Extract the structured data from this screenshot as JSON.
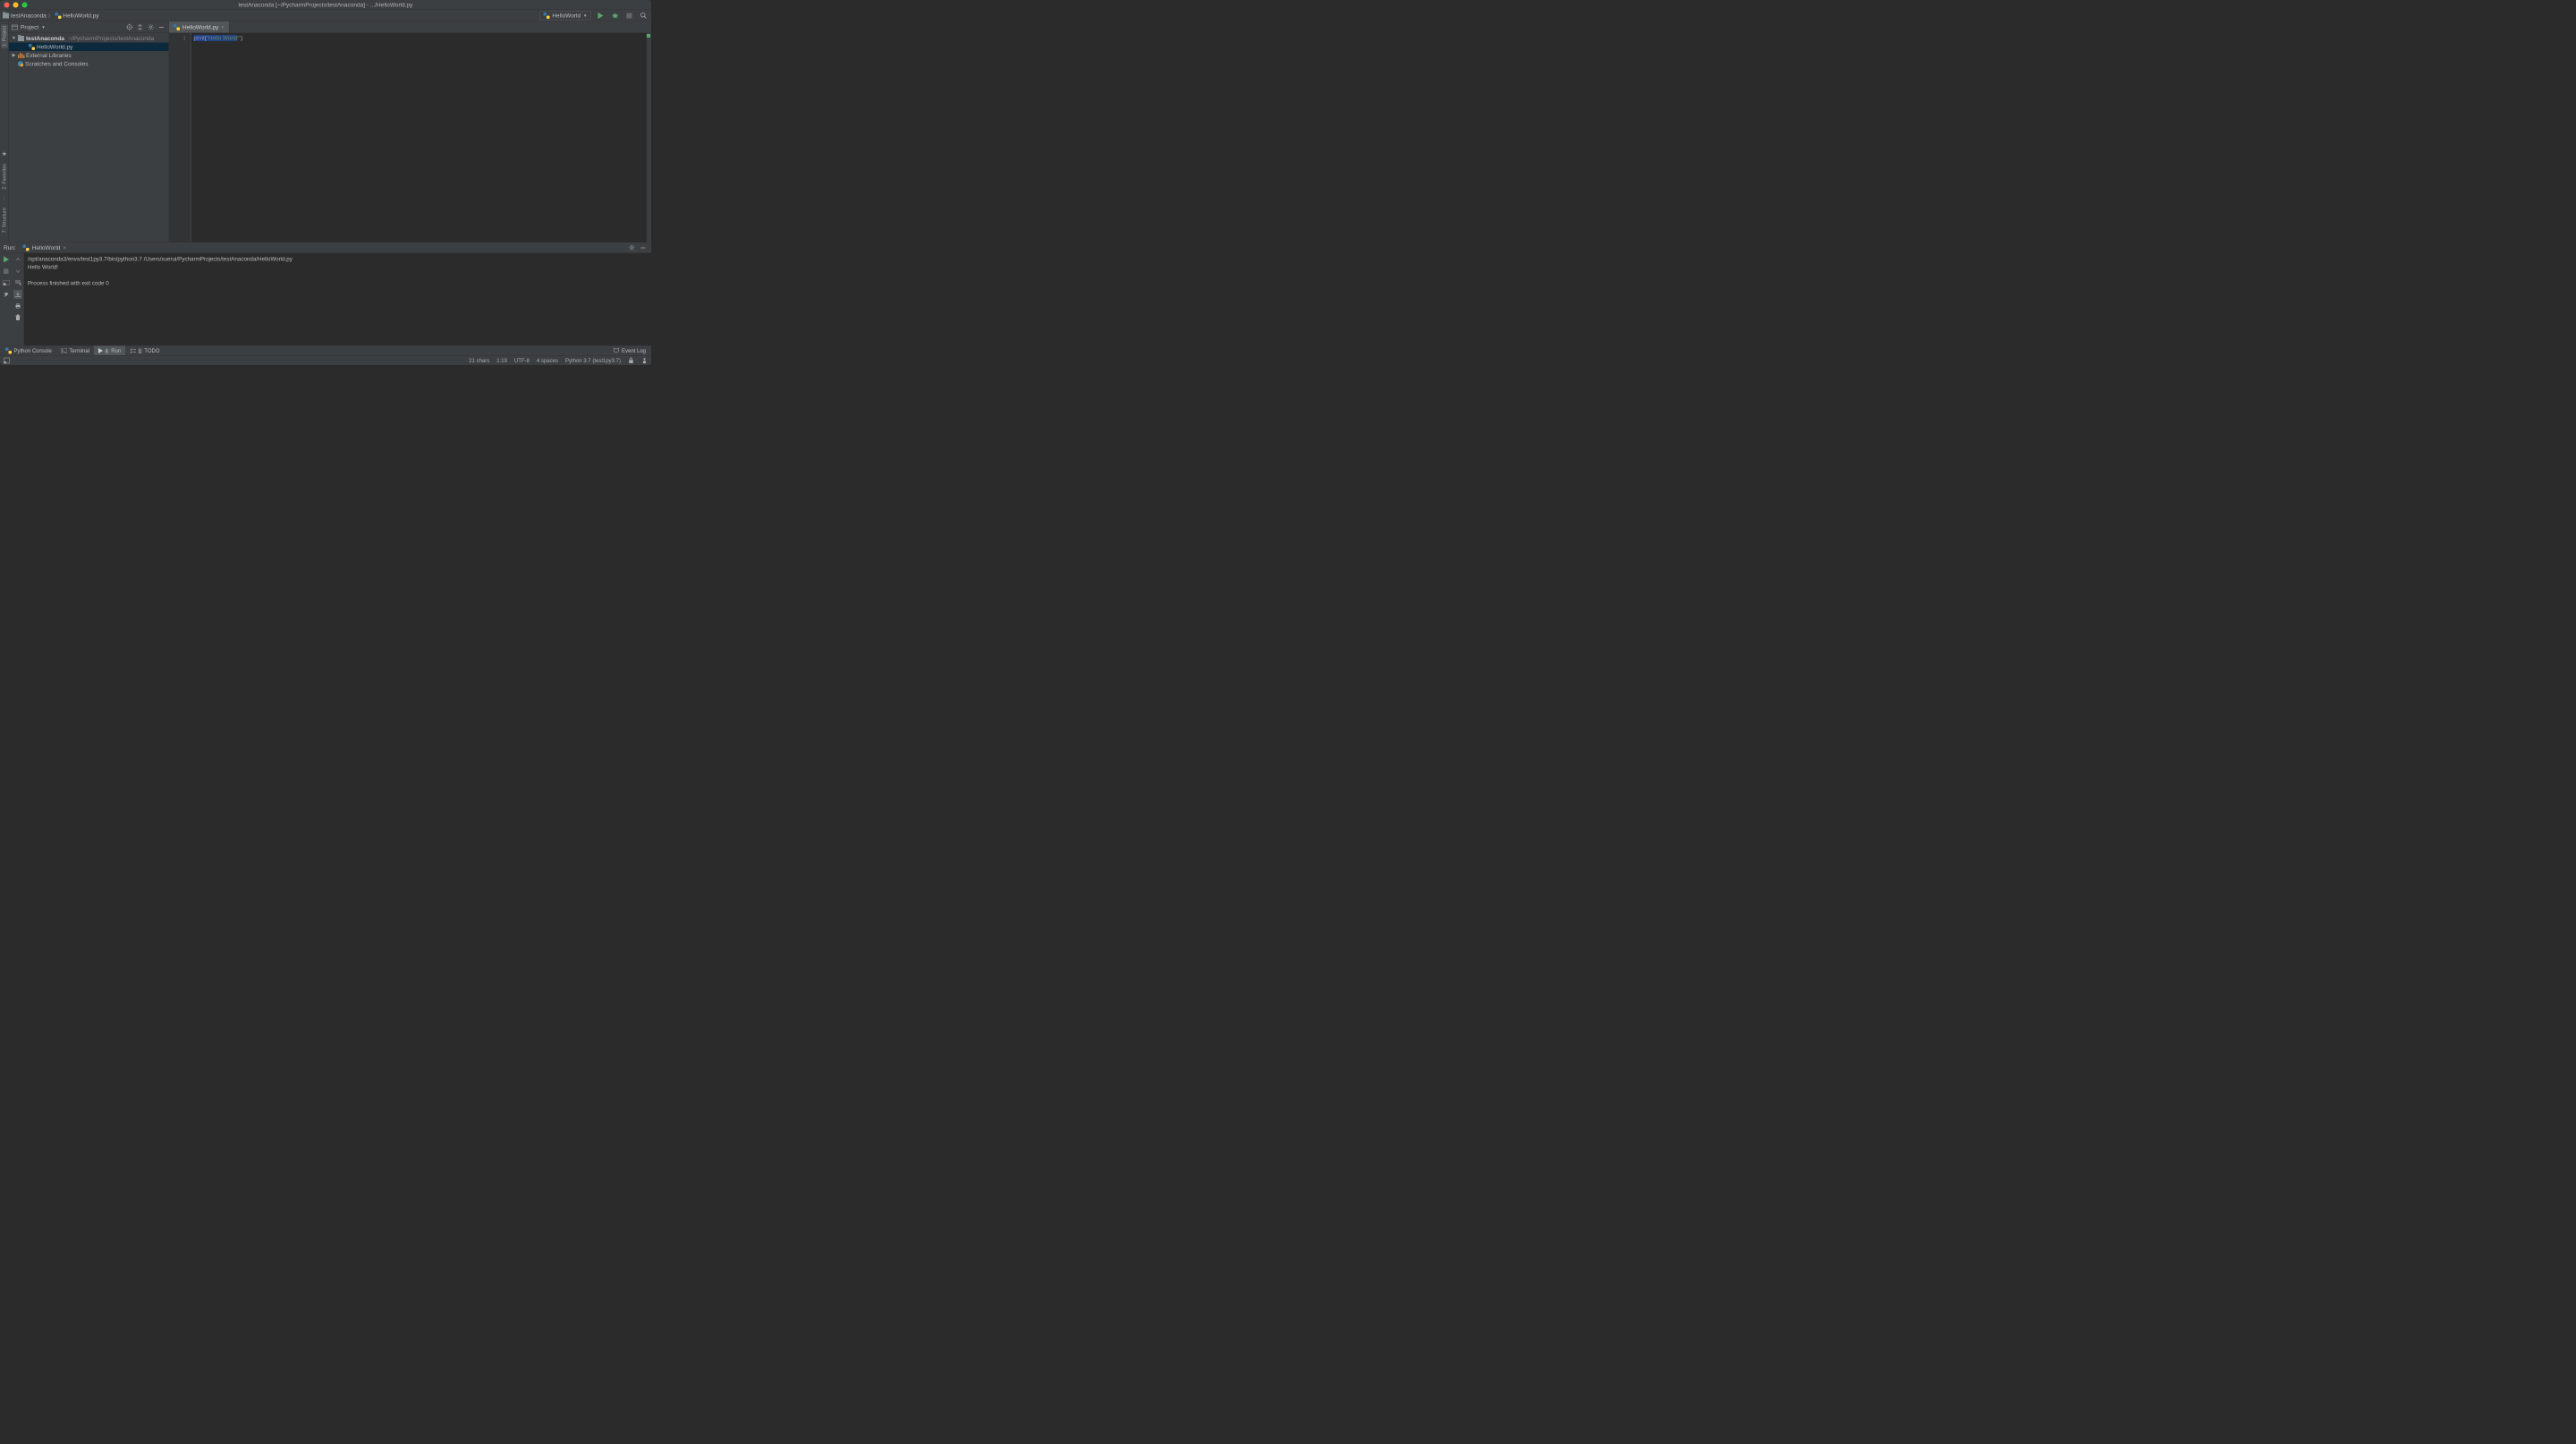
{
  "titlebar": {
    "title": "testAnaconda [~/PycharmProjects/testAnaconda] - .../HelloWorld.py"
  },
  "breadcrumb": {
    "project": "testAnaconda",
    "file": "HelloWorld.py"
  },
  "run_config": {
    "label": "HelloWorld"
  },
  "project_panel": {
    "title": "Project",
    "root": "testAnaconda",
    "root_path": "~/PycharmProjects/testAnaconda",
    "file1": "HelloWorld.py",
    "ext_libs": "External Libraries",
    "scratches": "Scratches and Consoles"
  },
  "left_strip": {
    "project": "1: Project",
    "favorites": "2: Favorites",
    "structure": "7: Structure"
  },
  "editor": {
    "tab": "HelloWorld.py",
    "line_number": "1",
    "code_kw": "print",
    "code_paren_open": "(",
    "code_str_q1": "\"",
    "code_str_content": "Hello World",
    "code_str_tail": "!\"",
    "code_paren_close": ")"
  },
  "run_panel": {
    "label": "Run:",
    "tab": "HelloWorld",
    "line1": "/opt/anaconda3/envs/test1py3.7/bin/python3.7 /Users/xuerui/PycharmProjects/testAnaconda/HelloWorld.py",
    "line2": "Hello World!",
    "line3": "",
    "line4": "Process finished with exit code 0"
  },
  "tool_bar": {
    "python_console": "Python Console",
    "terminal": "Terminal",
    "run_prefix": "4",
    "run_suffix": ": Run",
    "todo_prefix": "6",
    "todo_suffix": ": TODO",
    "event_log": "Event Log"
  },
  "status_bar": {
    "chars": "21 chars",
    "pos": "1:19",
    "encoding": "UTF-8",
    "indent": "4 spaces",
    "interpreter": "Python 3.7 (test1py3.7)"
  }
}
